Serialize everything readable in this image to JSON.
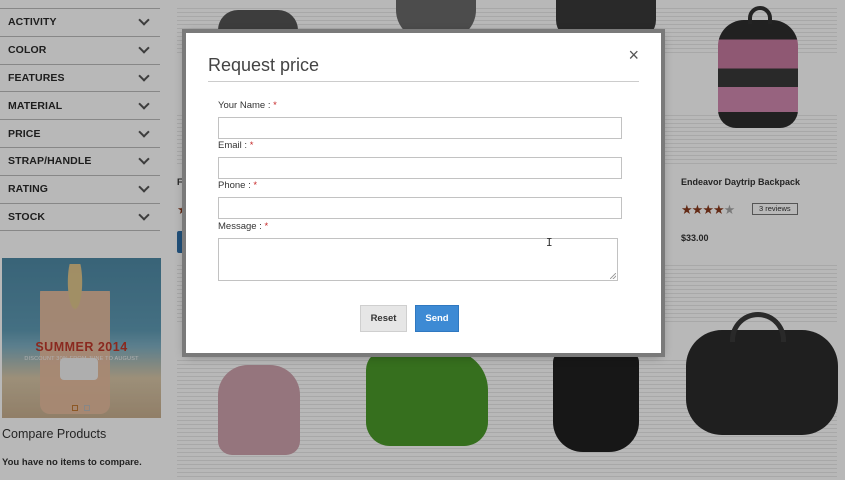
{
  "sidebar": {
    "filters": [
      {
        "label": "ACTIVITY"
      },
      {
        "label": "COLOR"
      },
      {
        "label": "FEATURES"
      },
      {
        "label": "MATERIAL"
      },
      {
        "label": "PRICE"
      },
      {
        "label": "STRAP/HANDLE"
      },
      {
        "label": "RATING"
      },
      {
        "label": "STOCK"
      }
    ],
    "banner": {
      "title": "SUMMER 2014",
      "subtitle": "DISCOUNT 30% FROM JUNE TO AUGUST"
    },
    "compare": {
      "title": "Compare Products",
      "text": "You have no items to compare."
    }
  },
  "products": {
    "visible_product": {
      "name": "Endeavor Daytrip Backpack",
      "rating_stars": 4,
      "rating_max": 5,
      "reviews_label": "3 reviews",
      "price": "$33.00"
    },
    "left_cut_name": "Fu"
  },
  "modal": {
    "title": "Request price",
    "close_glyph": "×",
    "fields": {
      "name_label": "Your Name : ",
      "email_label": "Email : ",
      "phone_label": "Phone : ",
      "message_label": "Message : ",
      "required_mark": "*"
    },
    "buttons": {
      "reset": "Reset",
      "send": "Send"
    }
  },
  "colors": {
    "send_button": "#3d8ad4",
    "required": "#c62828",
    "star": "#8a3b1e",
    "banner_title": "#c0392b"
  }
}
